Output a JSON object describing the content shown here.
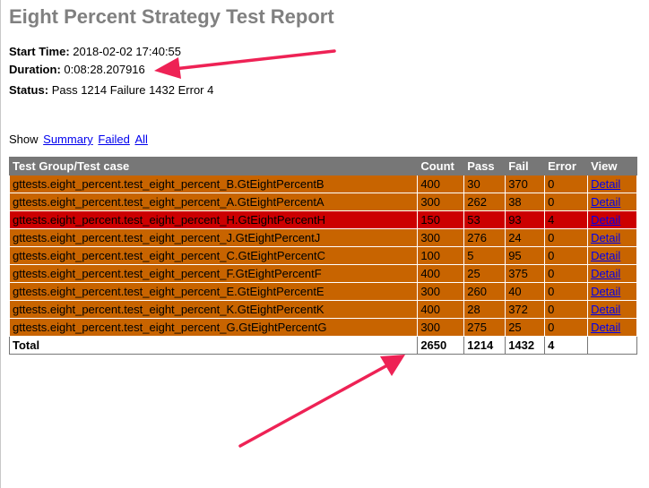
{
  "title": "Eight Percent Strategy Test Report",
  "attributes": {
    "start_label": "Start Time:",
    "start_value": "2018-02-02 17:40:55",
    "duration_label": "Duration:",
    "duration_value": "0:08:28.207916",
    "status_label": "Status:",
    "status_value": "Pass 1214 Failure 1432 Error 4"
  },
  "show": {
    "label": "Show",
    "summary": "Summary",
    "failed": "Failed",
    "all": "All"
  },
  "table": {
    "headers": [
      "Test Group/Test case",
      "Count",
      "Pass",
      "Fail",
      "Error",
      "View"
    ],
    "rows": [
      {
        "name": "gttests.eight_percent.test_eight_percent_B.GtEightPercentB",
        "count": "400",
        "pass": "30",
        "fail": "370",
        "error": "0",
        "view": "Detail"
      },
      {
        "name": "gttests.eight_percent.test_eight_percent_A.GtEightPercentA",
        "count": "300",
        "pass": "262",
        "fail": "38",
        "error": "0",
        "view": "Detail"
      },
      {
        "name": "gttests.eight_percent.test_eight_percent_H.GtEightPercentH",
        "count": "150",
        "pass": "53",
        "fail": "93",
        "error": "4",
        "view": "Detail"
      },
      {
        "name": "gttests.eight_percent.test_eight_percent_J.GtEightPercentJ",
        "count": "300",
        "pass": "276",
        "fail": "24",
        "error": "0",
        "view": "Detail"
      },
      {
        "name": "gttests.eight_percent.test_eight_percent_C.GtEightPercentC",
        "count": "100",
        "pass": "5",
        "fail": "95",
        "error": "0",
        "view": "Detail"
      },
      {
        "name": "gttests.eight_percent.test_eight_percent_F.GtEightPercentF",
        "count": "400",
        "pass": "25",
        "fail": "375",
        "error": "0",
        "view": "Detail"
      },
      {
        "name": "gttests.eight_percent.test_eight_percent_E.GtEightPercentE",
        "count": "300",
        "pass": "260",
        "fail": "40",
        "error": "0",
        "view": "Detail"
      },
      {
        "name": "gttests.eight_percent.test_eight_percent_K.GtEightPercentK",
        "count": "400",
        "pass": "28",
        "fail": "372",
        "error": "0",
        "view": "Detail"
      },
      {
        "name": "gttests.eight_percent.test_eight_percent_G.GtEightPercentG",
        "count": "300",
        "pass": "275",
        "fail": "25",
        "error": "0",
        "view": "Detail"
      }
    ],
    "total": {
      "label": "Total",
      "count": "2650",
      "pass": "1214",
      "fail": "1432",
      "error": "4"
    }
  },
  "colors": {
    "fail_row": "#c86400",
    "error_row": "#cc0000",
    "header_row": "#777777",
    "annotation_arrow": "#ee2255"
  }
}
